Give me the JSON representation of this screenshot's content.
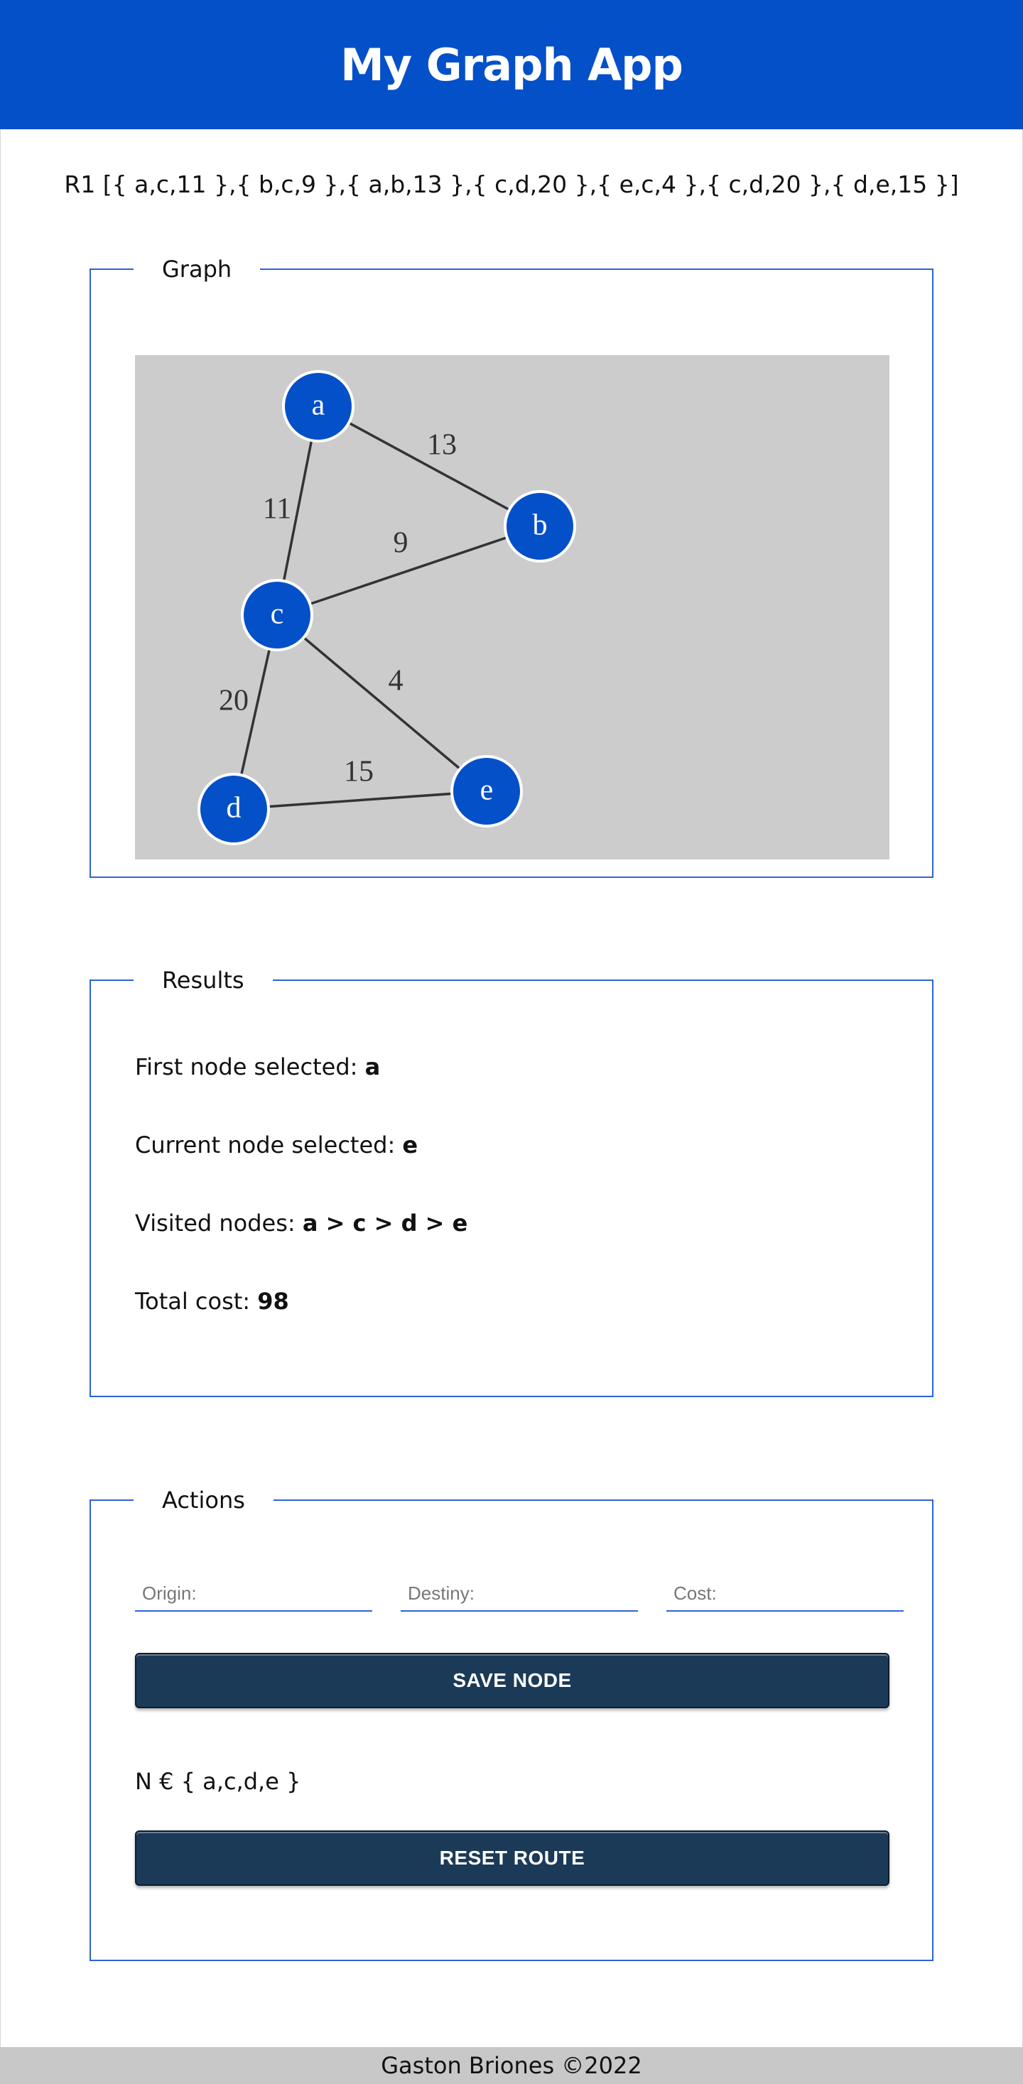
{
  "header": {
    "title": "My Graph App"
  },
  "route": {
    "text": "R1 [{ a,c,11 },{ b,c,9 },{ a,b,13 },{ c,d,20 },{ e,c,4 },{ c,d,20 },{ d,e,15 }]"
  },
  "graph_panel": {
    "legend": "Graph",
    "nodes": [
      {
        "id": "a",
        "label": "a"
      },
      {
        "id": "b",
        "label": "b"
      },
      {
        "id": "c",
        "label": "c"
      },
      {
        "id": "d",
        "label": "d"
      },
      {
        "id": "e",
        "label": "e"
      }
    ],
    "edges": [
      {
        "from": "a",
        "to": "b",
        "weight": "13"
      },
      {
        "from": "a",
        "to": "c",
        "weight": "11"
      },
      {
        "from": "b",
        "to": "c",
        "weight": "9"
      },
      {
        "from": "c",
        "to": "d",
        "weight": "20"
      },
      {
        "from": "c",
        "to": "e",
        "weight": "4"
      },
      {
        "from": "d",
        "to": "e",
        "weight": "15"
      }
    ],
    "colors": {
      "node_fill": "#0450c8",
      "canvas_bg": "#cccccc",
      "edge": "#333333"
    }
  },
  "results_panel": {
    "legend": "Results",
    "first_node": {
      "label": "First node selected: ",
      "value": "a"
    },
    "current_node": {
      "label": "Current node selected: ",
      "value": "e"
    },
    "visited": {
      "label": "Visited nodes: ",
      "value": "a > c > d > e"
    },
    "total_cost": {
      "label": "Total cost: ",
      "value": "98"
    }
  },
  "actions_panel": {
    "legend": "Actions",
    "origin_placeholder": "Origin:",
    "origin_value": "",
    "destiny_placeholder": "Destiny:",
    "destiny_value": "",
    "cost_placeholder": "Cost:",
    "cost_value": "",
    "save_label": "SAVE NODE",
    "node_set": "N € { a,c,d,e }",
    "reset_label": "RESET ROUTE"
  },
  "footer": {
    "text": "Gaston Briones ©2022"
  },
  "theme": {
    "primary": "#0450c8",
    "button": "#1b3a57",
    "panel_border": "#2e63d6",
    "footer_bg": "#c8c8c8"
  }
}
